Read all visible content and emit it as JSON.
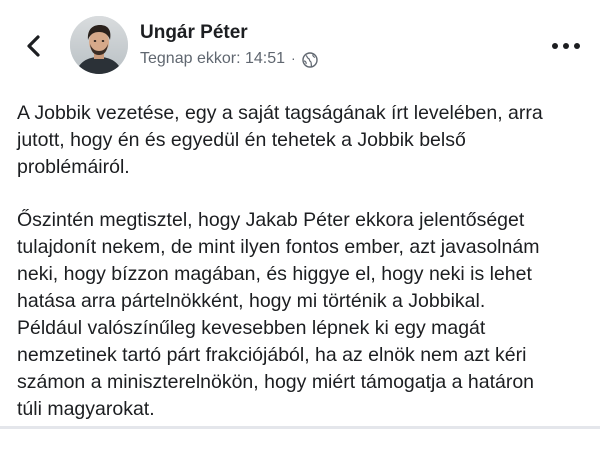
{
  "post": {
    "author_name": "Ungár Péter",
    "timestamp": "Tegnap ekkor: 14:51",
    "separator": "·",
    "audience_icon": "globe-icon",
    "paragraphs": [
      {
        "lines": [
          "A Jobbik vezetése, egy a saját tagságának írt levelében, arra",
          "jutott, hogy én és egyedül én tehetek a Jobbik belső",
          "problémáiról."
        ]
      },
      {
        "lines": [
          "Őszintén megtisztel, hogy Jakab Péter ekkora jelentőséget",
          "tulajdonít nekem, de mint ilyen fontos ember, azt javasolnám",
          "neki, hogy bízzon magában, és higgye el, hogy neki is lehet",
          "hatása arra pártelnökként, hogy mi történik a Jobbikal.",
          "Például valószínűleg kevesebben lépnek ki egy magát",
          "nemzetinek tartó párt frakciójából, ha az elnök nem azt kéri",
          "számon a miniszterelnökön, hogy miért támogatja a határon",
          "túli magyarokat."
        ]
      }
    ]
  },
  "header": {
    "back_icon": "chevron-left-icon",
    "more_icon": "more-dots-icon"
  },
  "colors": {
    "text_primary": "#1c1e21",
    "text_secondary": "#606770",
    "divider": "#e4e6eb"
  }
}
